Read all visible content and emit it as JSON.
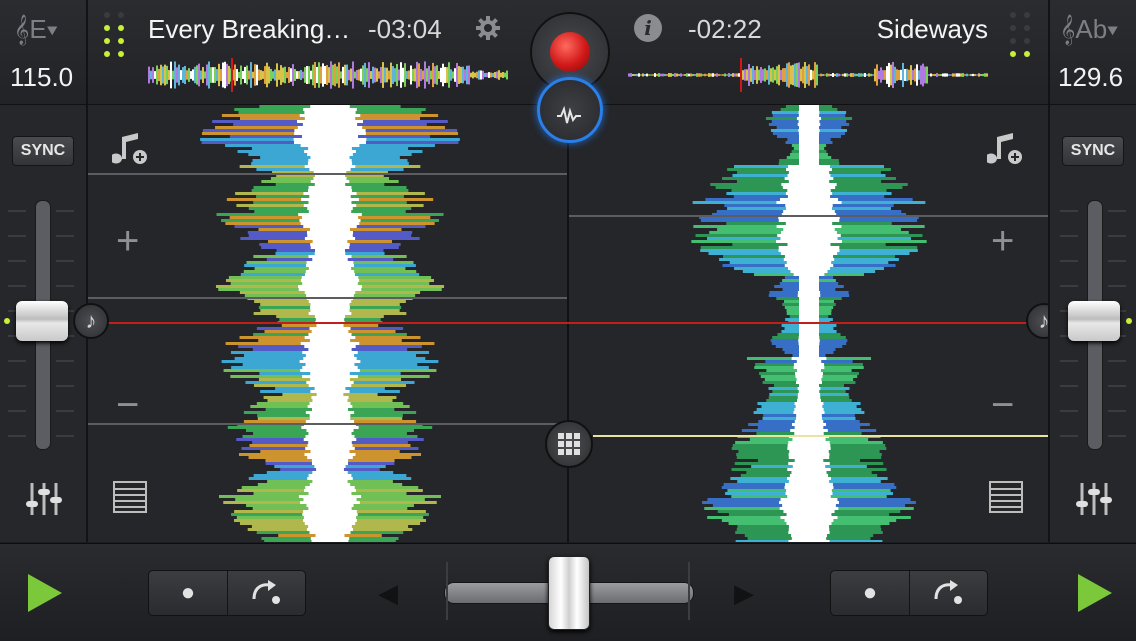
{
  "left_deck": {
    "key": "𝄞E▾",
    "bpm": "115.0",
    "title": "Every Breaking…",
    "time": "-03:04",
    "sync_label": "SYNC",
    "level_dots": [
      false,
      false,
      true,
      true,
      true,
      true,
      true,
      true
    ],
    "pitch_level": 0.5,
    "playhead": 0.23
  },
  "right_deck": {
    "key": "𝄞Ab▾",
    "bpm": "129.6",
    "title": "Sideways",
    "time": "-02:22",
    "sync_label": "SYNC",
    "level_dots": [
      false,
      false,
      false,
      false,
      false,
      false,
      true,
      true
    ],
    "pitch_level": 0.5,
    "playhead": 0.31
  },
  "icons": {
    "settings": "gear-icon",
    "info": "info-icon",
    "record": "record-icon",
    "add_music": "add-music-icon",
    "plus": "+",
    "minus": "−",
    "note": "♪",
    "list": "list-icon",
    "grid": "grid-icon",
    "mixer": "mixer-icon",
    "play": "play-icon",
    "cue": "●",
    "loop": "loop-icon",
    "nudge_left": "◀",
    "nudge_right": "▶"
  },
  "crossfader": {
    "position": 0.5
  },
  "colors": {
    "accent_green": "#7cc83b",
    "record_red": "#d01818",
    "level_on": "#c8f03a",
    "playhead": "#c0201a",
    "beat_line": "#e8e3a0"
  }
}
